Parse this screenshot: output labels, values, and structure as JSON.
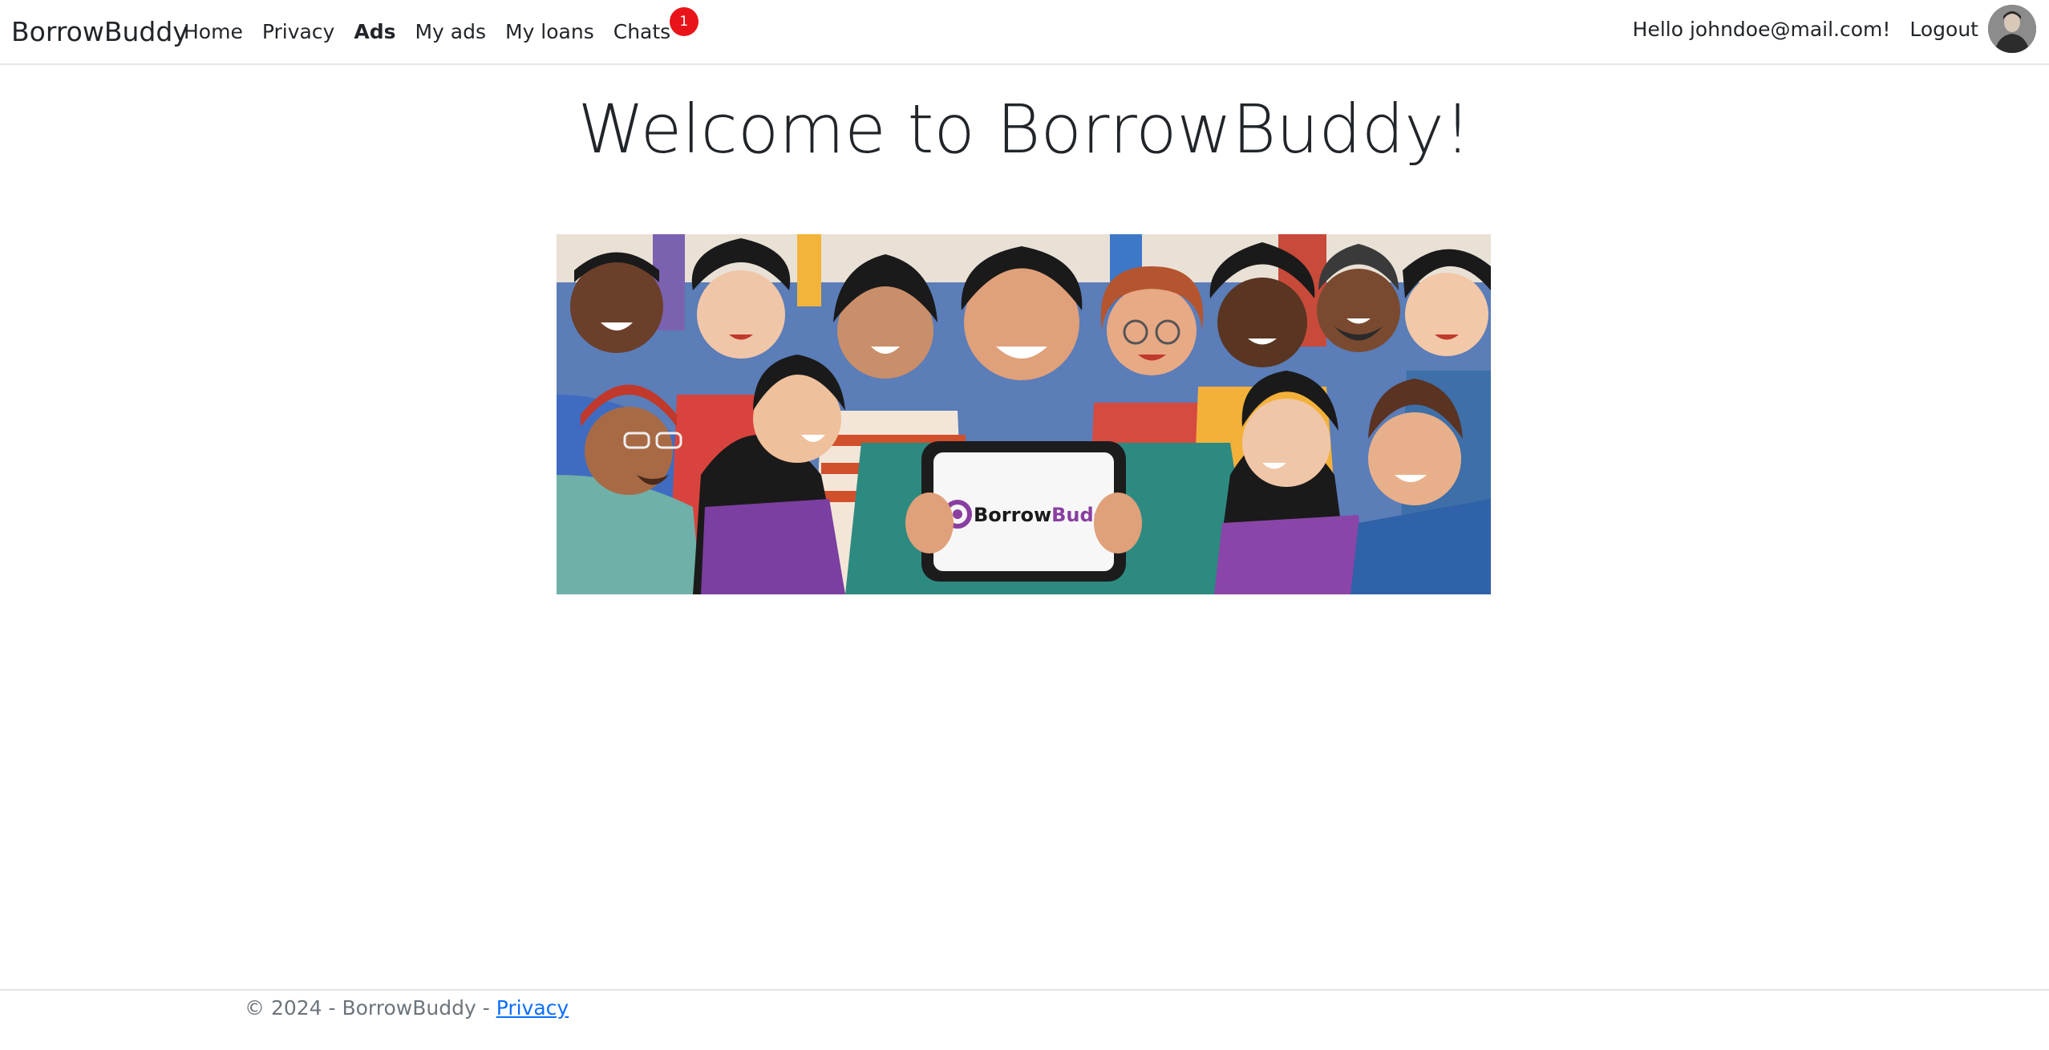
{
  "nav": {
    "brand": "BorrowBuddy",
    "items": [
      {
        "label": "Home",
        "active": false
      },
      {
        "label": "Privacy",
        "active": false
      },
      {
        "label": "Ads",
        "active": true
      },
      {
        "label": "My ads",
        "active": false
      },
      {
        "label": "My loans",
        "active": false
      },
      {
        "label": "Chats",
        "active": false
      }
    ],
    "chats_badge": "1",
    "greeting": "Hello johndoe@mail.com!",
    "logout_label": "Logout"
  },
  "main": {
    "title": "Welcome to BorrowBuddy!",
    "hero_logo_text_a": "Borrow",
    "hero_logo_text_b": "Buddy"
  },
  "footer": {
    "text": "© 2024 - BorrowBuddy - ",
    "link_label": "Privacy"
  },
  "colors": {
    "badge": "#e8141a",
    "link": "#0d6efd",
    "brand_purple": "#8a3fa0"
  }
}
